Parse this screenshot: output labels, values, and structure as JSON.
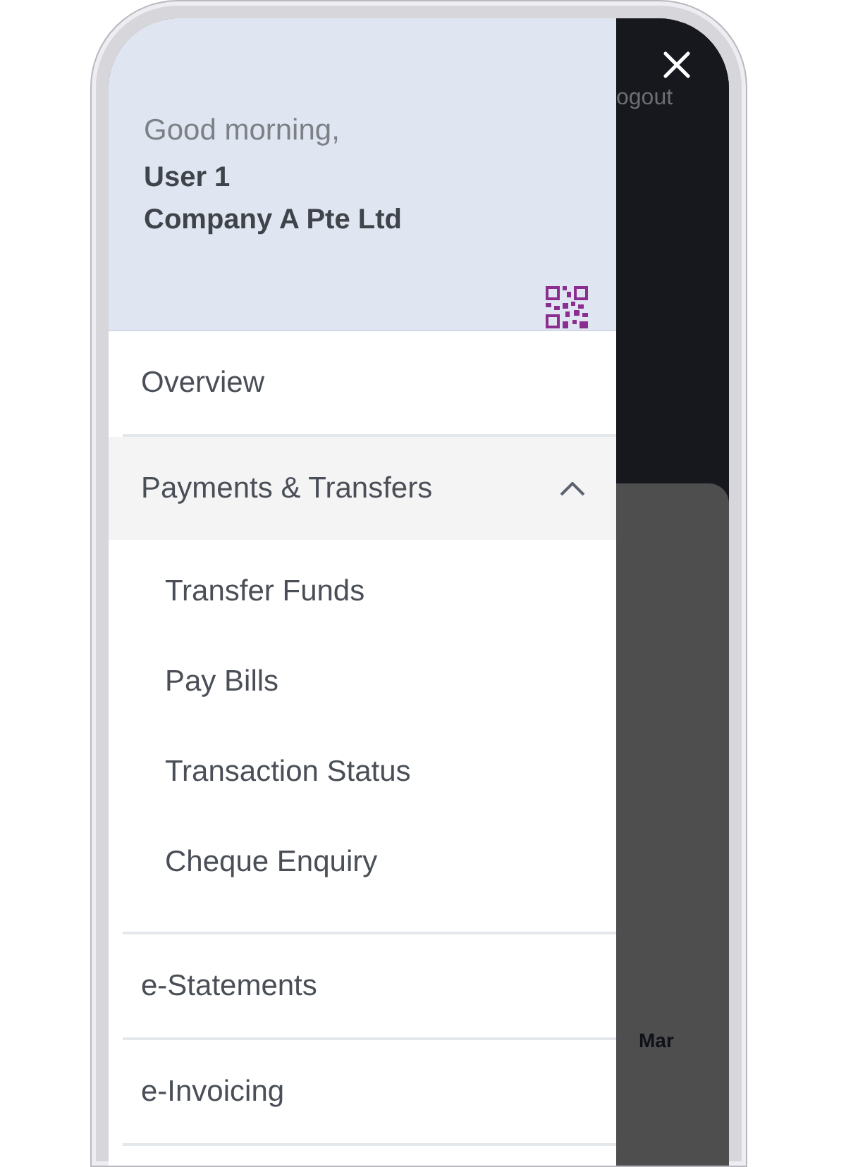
{
  "drawer": {
    "greeting": "Good morning,",
    "user_name": "User 1",
    "company": "Company A Pte Ltd",
    "menu": [
      {
        "kind": "link",
        "label": "Overview"
      },
      {
        "kind": "group",
        "label": "Payments & Transfers",
        "expanded": true,
        "children": [
          {
            "label": "Transfer Funds"
          },
          {
            "label": "Pay Bills"
          },
          {
            "label": "Transaction Status"
          },
          {
            "label": "Cheque Enquiry"
          }
        ]
      },
      {
        "kind": "link",
        "label": "e-Statements"
      },
      {
        "kind": "link",
        "label": "e-Invoicing"
      }
    ]
  },
  "background": {
    "logout": "ogout",
    "month": "Mar"
  }
}
